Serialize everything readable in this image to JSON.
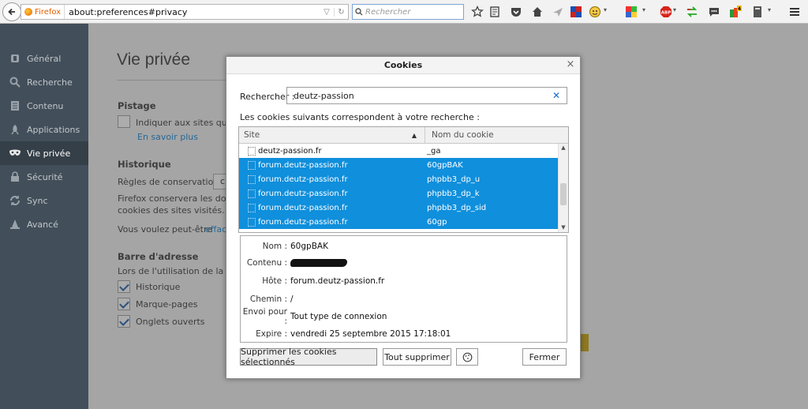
{
  "browser": {
    "brand": "Firefox",
    "url": "about:preferences#privacy",
    "search_placeholder": "Rechercher",
    "notification_count": "4"
  },
  "sidebar": {
    "items": [
      {
        "label": "Général"
      },
      {
        "label": "Recherche"
      },
      {
        "label": "Contenu"
      },
      {
        "label": "Applications"
      },
      {
        "label": "Vie privée"
      },
      {
        "label": "Sécurité"
      },
      {
        "label": "Sync"
      },
      {
        "label": "Avancé"
      }
    ]
  },
  "page": {
    "title": "Vie privée",
    "tracking_heading": "Pistage",
    "tracking_option": "Indiquer aux sites qu",
    "learn_more": "En savoir plus",
    "history_heading": "Historique",
    "retention_label": "Règles de conservation :",
    "retention_value": "c",
    "history_text_1": "Firefox conservera les donne",
    "history_text_2": "cookies des sites visités.",
    "history_text_3": "Vous voulez peut-être",
    "history_link": "effac",
    "address_heading": "Barre d'adresse",
    "address_intro": "Lors de l'utilisation de la ba",
    "address_opts": [
      "Historique",
      "Marque-pages",
      "Onglets ouverts"
    ]
  },
  "dialog": {
    "title": "Cookies",
    "search_label": "Rechercher :",
    "search_value": "deutz-passion",
    "info": "Les cookies suivants correspondent à votre recherche :",
    "col_site": "Site",
    "col_name": "Nom du cookie",
    "rows": [
      {
        "site": "deutz-passion.fr",
        "name": "_ga",
        "selected": false
      },
      {
        "site": "forum.deutz-passion.fr",
        "name": "60gpBAK",
        "selected": true
      },
      {
        "site": "forum.deutz-passion.fr",
        "name": "phpbb3_dp_u",
        "selected": true
      },
      {
        "site": "forum.deutz-passion.fr",
        "name": "phpbb3_dp_k",
        "selected": true
      },
      {
        "site": "forum.deutz-passion.fr",
        "name": "phpbb3_dp_sid",
        "selected": true
      },
      {
        "site": "forum.deutz-passion.fr",
        "name": "60gp",
        "selected": true
      }
    ],
    "details": {
      "name_label": "Nom :",
      "name_value": "60gpBAK",
      "content_label": "Contenu :",
      "host_label": "Hôte :",
      "host_value": "forum.deutz-passion.fr",
      "path_label": "Chemin :",
      "path_value": "/",
      "send_label": "Envoi pour :",
      "send_value": "Tout type de connexion",
      "expires_label": "Expire :",
      "expires_value": "vendredi 25 septembre 2015 17:18:01"
    },
    "btn_delete_selected": "Supprimer les cookies sélectionnés",
    "btn_delete_all": "Tout supprimer",
    "btn_close": "Fermer"
  },
  "colors": {
    "selection": "#0f8fdc",
    "sidebar_bg": "#424f5a",
    "link": "#0a84d6"
  }
}
